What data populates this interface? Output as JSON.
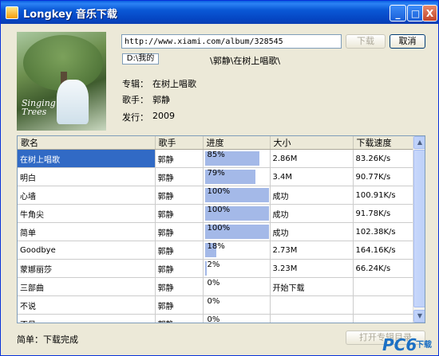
{
  "window": {
    "title": "Longkey 音乐下载",
    "min_label": "_",
    "max_label": "□",
    "close_label": "X"
  },
  "album_art": {
    "line1": "Singing",
    "line2": "Trees"
  },
  "url": {
    "value": "http://www.xiami.com/album/328545"
  },
  "buttons": {
    "download": "下载",
    "cancel": "取消",
    "path": "D:\\我的",
    "open_folder": "打开专辑目录"
  },
  "path_text": "\\郭静\\在树上唱歌\\",
  "info": {
    "album_label": "专辑：",
    "album_value": "在树上唱歌",
    "artist_label": "歌手：",
    "artist_value": "郭静",
    "release_label": "发行：",
    "release_value": "2009"
  },
  "table": {
    "headers": [
      "歌名",
      "歌手",
      "进度",
      "大小",
      "下载速度"
    ],
    "rows": [
      {
        "name": "在树上唱歌",
        "artist": "郭静",
        "progress": "85%",
        "fill": 0.85,
        "size": "2.86M",
        "speed": "83.26K/s"
      },
      {
        "name": "明白",
        "artist": "郭静",
        "progress": "79%",
        "fill": 0.79,
        "size": "3.4M",
        "speed": "90.77K/s"
      },
      {
        "name": "心墙",
        "artist": "郭静",
        "progress": "100%",
        "fill": 1.0,
        "size": "成功",
        "speed": "100.91K/s"
      },
      {
        "name": "牛角尖",
        "artist": "郭静",
        "progress": "100%",
        "fill": 1.0,
        "size": "成功",
        "speed": "91.78K/s"
      },
      {
        "name": "简单",
        "artist": "郭静",
        "progress": "100%",
        "fill": 1.0,
        "size": "成功",
        "speed": "102.38K/s"
      },
      {
        "name": "Goodbye",
        "artist": "郭静",
        "progress": "18%",
        "fill": 0.18,
        "size": "2.73M",
        "speed": "164.16K/s"
      },
      {
        "name": "蒙娜丽莎",
        "artist": "郭静",
        "progress": "2%",
        "fill": 0.02,
        "size": "3.23M",
        "speed": "66.24K/s"
      },
      {
        "name": "三部曲",
        "artist": "郭静",
        "progress": "0%",
        "fill": 0,
        "size": "开始下载",
        "speed": ""
      },
      {
        "name": "不说",
        "artist": "郭静",
        "progress": "0%",
        "fill": 0,
        "size": "",
        "speed": ""
      },
      {
        "name": "不见",
        "artist": "郭静",
        "progress": "0%",
        "fill": 0,
        "size": "",
        "speed": ""
      }
    ]
  },
  "scrollbar": {
    "up": "▲",
    "down": "▼"
  },
  "status": "简单：下载完成",
  "watermark": {
    "main": "PC6",
    "sub": "下载"
  }
}
